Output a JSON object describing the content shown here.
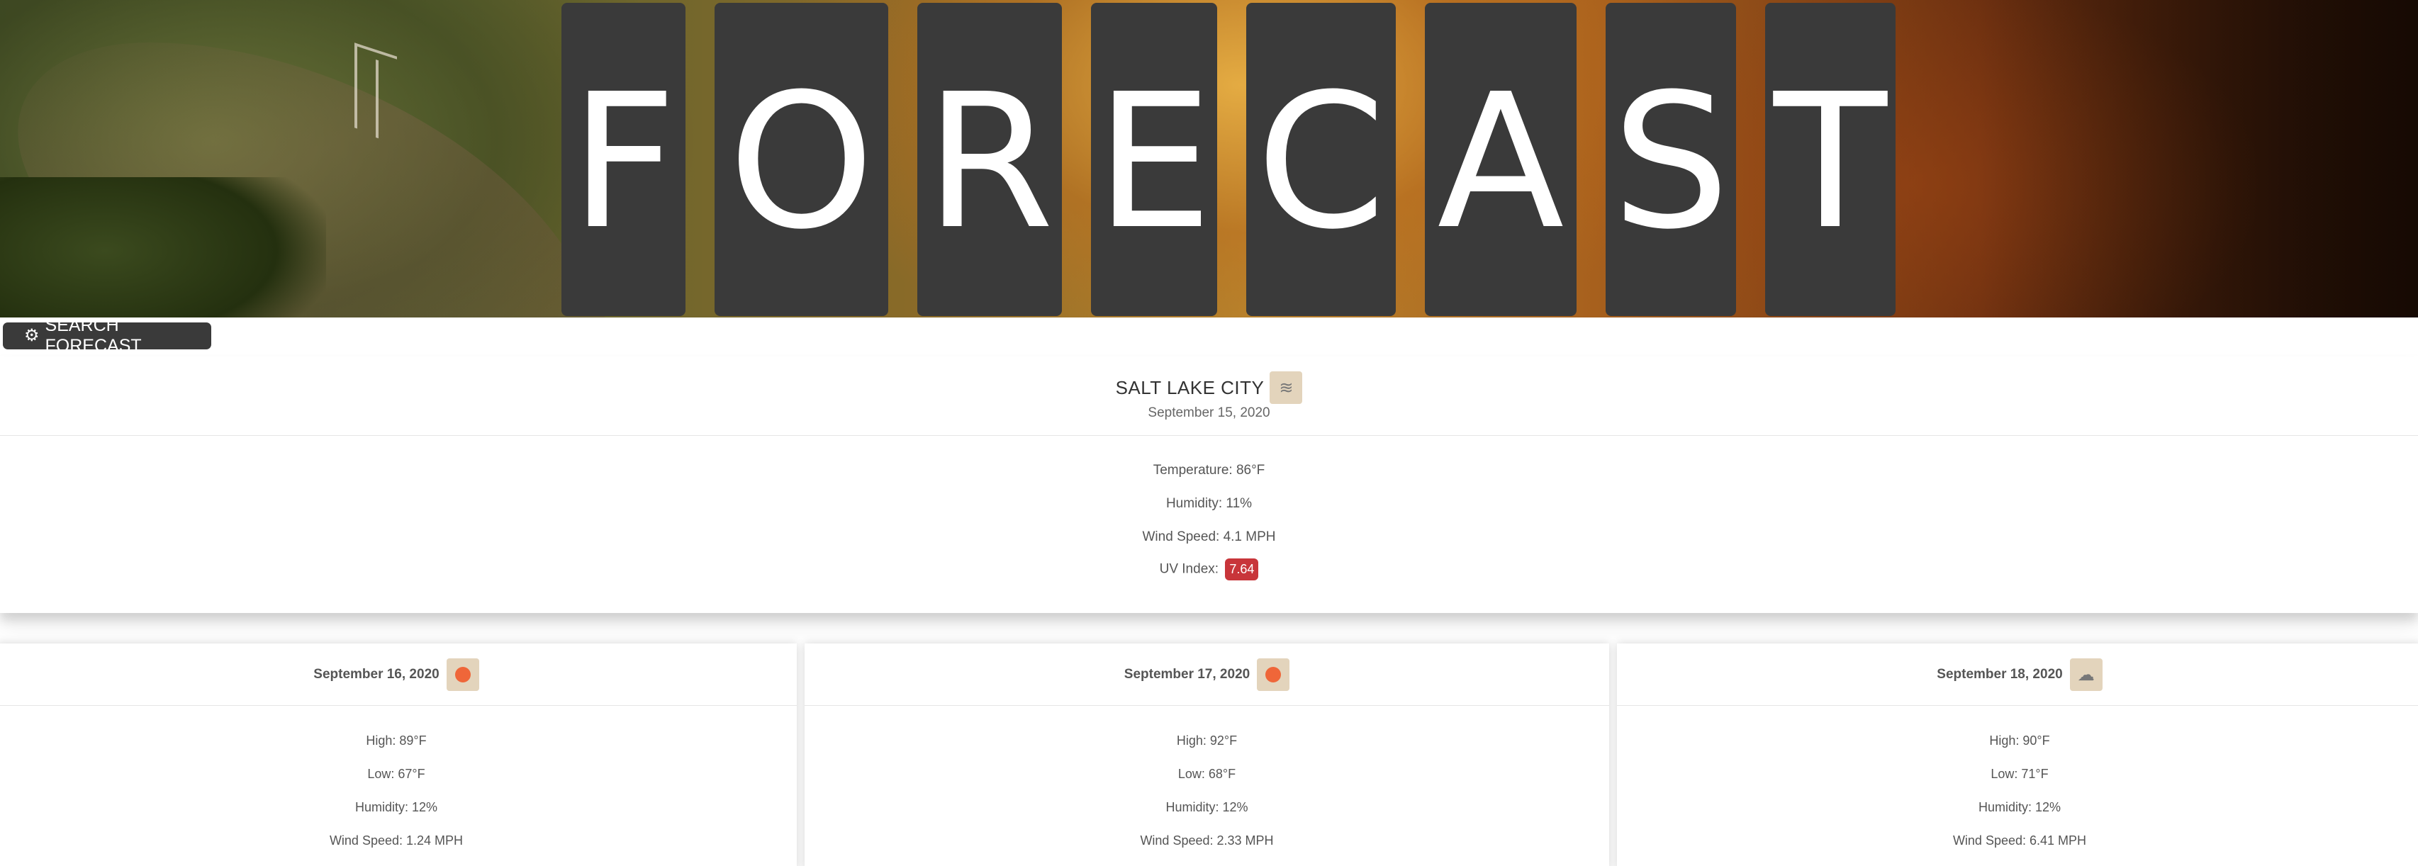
{
  "header": {
    "title_letters": [
      "F",
      "O",
      "R",
      "E",
      "C",
      "A",
      "S",
      "T"
    ]
  },
  "search_button": {
    "icon": "gear-icon",
    "label": "SEARCH FORECAST"
  },
  "current": {
    "city": "SALT LAKE CITY",
    "icon": "haze-icon",
    "date": "September 15, 2020",
    "temperature": "Temperature: 86°F",
    "humidity": "Humidity: 11%",
    "wind_speed": "Wind Speed: 4.1 MPH",
    "uv_label": "UV Index:",
    "uv_value": "7.64",
    "uv_color": "#c8353a"
  },
  "forecast": [
    {
      "date": "September 16, 2020",
      "icon": "sun-icon",
      "high": "High: 89°F",
      "low": "Low: 67°F",
      "humidity": "Humidity: 12%",
      "wind_speed": "Wind Speed: 1.24 MPH"
    },
    {
      "date": "September 17, 2020",
      "icon": "sun-icon",
      "high": "High: 92°F",
      "low": "Low: 68°F",
      "humidity": "Humidity: 12%",
      "wind_speed": "Wind Speed: 2.33 MPH"
    },
    {
      "date": "September 18, 2020",
      "icon": "partly-cloudy-icon",
      "high": "High: 90°F",
      "low": "Low: 71°F",
      "humidity": "Humidity: 12%",
      "wind_speed": "Wind Speed: 6.41 MPH"
    }
  ],
  "colors": {
    "tile": "#3a3a3a",
    "icon_bg": "#e3d4bc",
    "sun": "#f05a2a"
  }
}
